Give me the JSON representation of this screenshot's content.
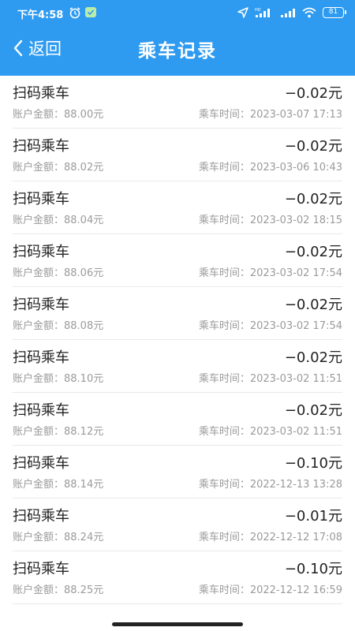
{
  "status_bar": {
    "time": "下午4:58",
    "battery": "81"
  },
  "nav": {
    "back_label": "返回",
    "title": "乘车记录"
  },
  "colors": {
    "header_bg": "#2e9bf0",
    "text_primary": "#222222",
    "text_secondary": "#9a9a9a"
  },
  "records": [
    {
      "type": "扫码乘车",
      "amount": "−0.02元",
      "balance": "账户金额：88.00元",
      "time": "乘车时间：2023-03-07 17:13"
    },
    {
      "type": "扫码乘车",
      "amount": "−0.02元",
      "balance": "账户金额：88.02元",
      "time": "乘车时间：2023-03-06 10:43"
    },
    {
      "type": "扫码乘车",
      "amount": "−0.02元",
      "balance": "账户金额：88.04元",
      "time": "乘车时间：2023-03-02 18:15"
    },
    {
      "type": "扫码乘车",
      "amount": "−0.02元",
      "balance": "账户金额：88.06元",
      "time": "乘车时间：2023-03-02 17:54"
    },
    {
      "type": "扫码乘车",
      "amount": "−0.02元",
      "balance": "账户金额：88.08元",
      "time": "乘车时间：2023-03-02 17:54"
    },
    {
      "type": "扫码乘车",
      "amount": "−0.02元",
      "balance": "账户金额：88.10元",
      "time": "乘车时间：2023-03-02 11:51"
    },
    {
      "type": "扫码乘车",
      "amount": "−0.02元",
      "balance": "账户金额：88.12元",
      "time": "乘车时间：2023-03-02 11:51"
    },
    {
      "type": "扫码乘车",
      "amount": "−0.10元",
      "balance": "账户金额：88.14元",
      "time": "乘车时间：2022-12-13 13:28"
    },
    {
      "type": "扫码乘车",
      "amount": "−0.01元",
      "balance": "账户金额：88.24元",
      "time": "乘车时间：2022-12-12 17:08"
    },
    {
      "type": "扫码乘车",
      "amount": "−0.10元",
      "balance": "账户金额：88.25元",
      "time": "乘车时间：2022-12-12 16:59"
    }
  ]
}
